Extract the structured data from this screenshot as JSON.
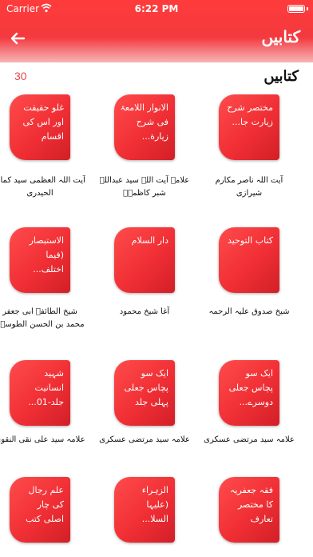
{
  "status_bar": {
    "carrier": "Carrier",
    "time": "6:22 PM"
  },
  "header": {
    "title": "کتابیں"
  },
  "count": "30",
  "section_title": "کتابیں",
  "books": [
    {
      "title": "مختصر شرح زیارت جا...",
      "author": "آیت اللہ ناصر مکارم شیرازی"
    },
    {
      "title": "الانوار اللامعۃ فی شرح زیارة...",
      "author": "علامہ آیت اللہ سید عبداللہ شبر کاظمیؒ"
    },
    {
      "title": "غلو حقیقت اور اس کی اقسام",
      "author": "آیت اللہ العظمی سید کمال الحیدری"
    },
    {
      "title": "کتاب التوحید",
      "author": "شیخ صدوق علیہ الرحمہ"
    },
    {
      "title": "دار السلام",
      "author": "آغا شیخ محمود"
    },
    {
      "title": "الاستبصار (فیما اختلف...",
      "author": "شیخ الطائفہ ابی جعفر محمد بن الحسن الطوسیؒ"
    },
    {
      "title": "ایک سو پچاس جعلی دوسرے...",
      "author": "علامہ سید مرتضی عسکری"
    },
    {
      "title": "ایک سو پچاس جعلی پہلی جلد",
      "author": "علامہ سید مرتضی عسکری"
    },
    {
      "title": "شہید انسانیت جلد-01...",
      "author": "علامہ سید علی نقی النقوی"
    },
    {
      "title": "فقہ جعفریہ کا مختصر تعارف",
      "author": ""
    },
    {
      "title": "الزہراء (علیہا السلا...",
      "author": ""
    },
    {
      "title": "علم رجال کی چار اصلی کتب",
      "author": ""
    }
  ]
}
